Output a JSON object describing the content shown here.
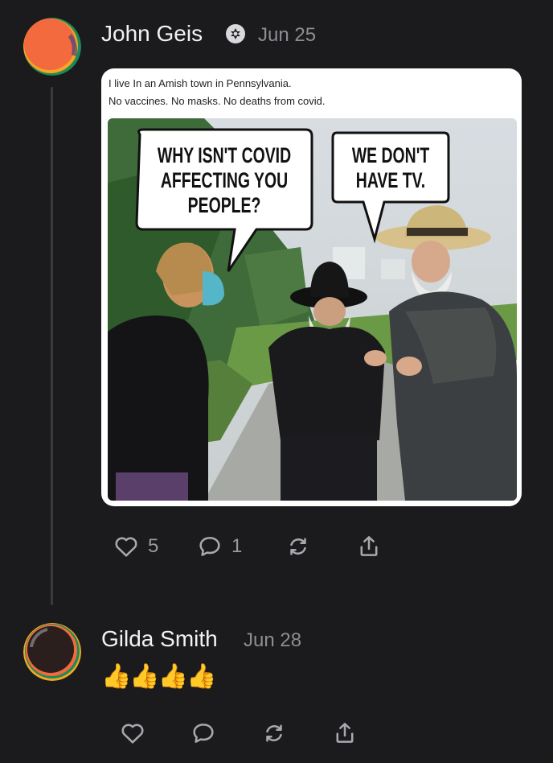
{
  "post": {
    "author": "John Geis",
    "date": "Jun 25",
    "badge_icon": "substack-badge-icon",
    "text_lines": [
      "I live In an Amish town in Pennsylvania.",
      "No vaccines. No masks. No deaths from covid."
    ],
    "meme": {
      "bubble_left_lines": [
        "WHY ISN'T COVID",
        "AFFECTING YOU",
        "PEOPLE?"
      ],
      "bubble_right_lines": [
        "WE DON'T",
        "HAVE TV."
      ]
    },
    "likes": "5",
    "comments": "1",
    "avatar_colors": [
      "#f26a3d",
      "#f5a623",
      "#1f8a57",
      "#2b3a8c"
    ]
  },
  "reply": {
    "author": "Gilda Smith",
    "date": "Jun 28",
    "text": "👍👍👍👍",
    "avatar_colors": [
      "#2a1f1c",
      "#f26a3d",
      "#1f8a57",
      "#f5a623"
    ]
  },
  "icons": {
    "like": "heart-icon",
    "comment": "comment-icon",
    "restack": "restack-icon",
    "share": "share-icon"
  },
  "colors": {
    "background": "#1b1b1d",
    "muted": "#8d8d93",
    "text": "#f2f2f4"
  }
}
